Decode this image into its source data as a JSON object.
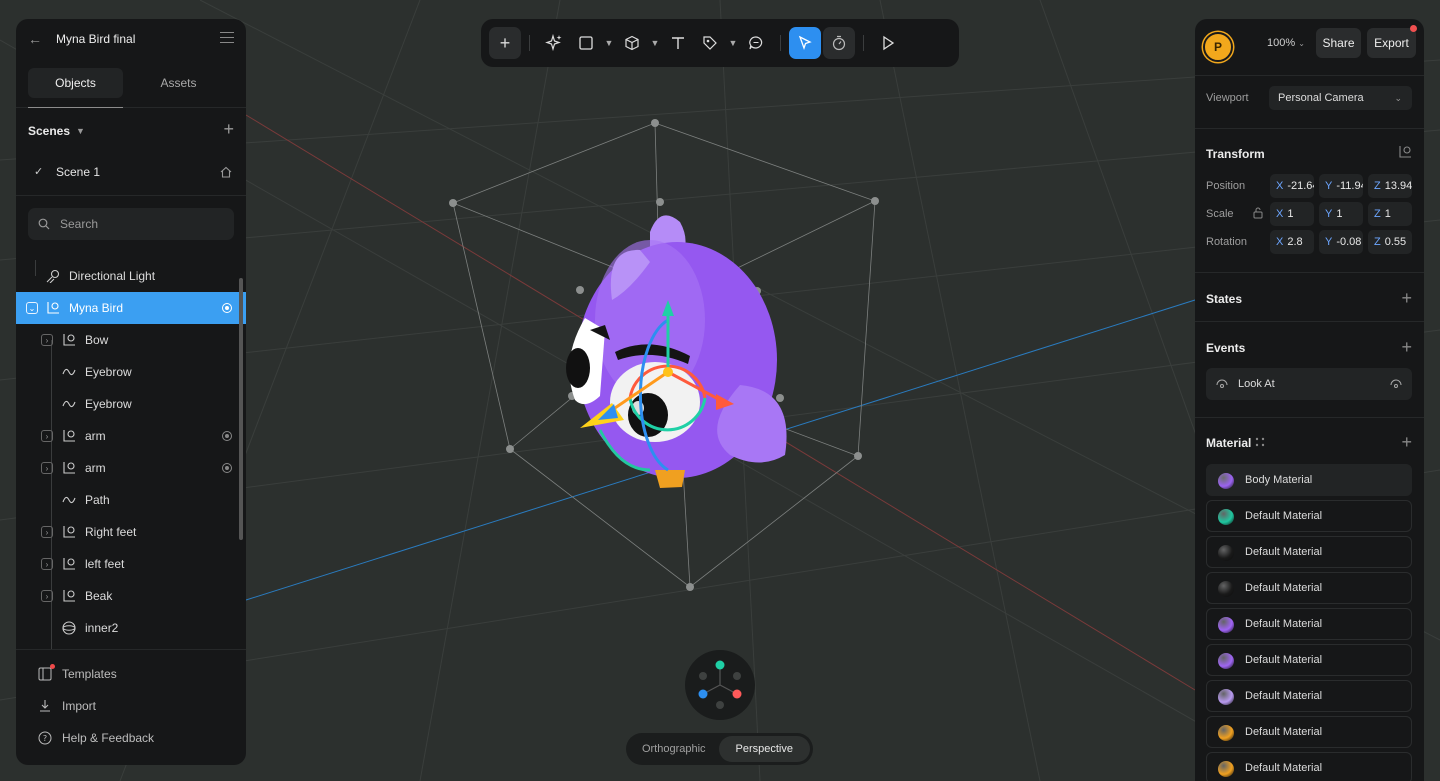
{
  "project": {
    "title": "Myna Bird final"
  },
  "tabs": {
    "objects": "Objects",
    "assets": "Assets"
  },
  "scenes": {
    "label": "Scenes",
    "items": [
      {
        "label": "Scene 1"
      }
    ]
  },
  "search": {
    "placeholder": "Search"
  },
  "layers": [
    {
      "label": "Directional Light",
      "icon": "light-icon",
      "depth": 0,
      "expandable": false,
      "visibility": false,
      "selected": false
    },
    {
      "label": "Myna Bird",
      "icon": "group-icon",
      "depth": 0,
      "expandable": true,
      "visibility": true,
      "selected": true
    },
    {
      "label": "Bow",
      "icon": "group-icon",
      "depth": 1,
      "expandable": true,
      "visibility": false,
      "selected": false
    },
    {
      "label": "Eyebrow",
      "icon": "path-icon",
      "depth": 1,
      "expandable": false,
      "visibility": false,
      "selected": false
    },
    {
      "label": "Eyebrow",
      "icon": "path-icon",
      "depth": 1,
      "expandable": false,
      "visibility": false,
      "selected": false
    },
    {
      "label": "arm",
      "icon": "group-icon",
      "depth": 1,
      "expandable": true,
      "visibility": true,
      "selected": false
    },
    {
      "label": "arm",
      "icon": "group-icon",
      "depth": 1,
      "expandable": true,
      "visibility": true,
      "selected": false
    },
    {
      "label": "Path",
      "icon": "path-icon",
      "depth": 1,
      "expandable": false,
      "visibility": false,
      "selected": false
    },
    {
      "label": "Right feet",
      "icon": "group-icon",
      "depth": 1,
      "expandable": true,
      "visibility": false,
      "selected": false
    },
    {
      "label": "left feet",
      "icon": "group-icon",
      "depth": 1,
      "expandable": true,
      "visibility": false,
      "selected": false
    },
    {
      "label": "Beak",
      "icon": "group-icon",
      "depth": 1,
      "expandable": true,
      "visibility": false,
      "selected": false
    },
    {
      "label": "inner2",
      "icon": "sphere-icon",
      "depth": 1,
      "expandable": false,
      "visibility": false,
      "selected": false
    }
  ],
  "footer": {
    "templates": "Templates",
    "import": "Import",
    "help": "Help & Feedback"
  },
  "toolbar": {
    "tools": [
      "plus",
      "ai-sparkle",
      "rectangle",
      "cube",
      "text",
      "pen",
      "comment",
      "select",
      "timer",
      "play"
    ]
  },
  "header": {
    "avatar_letter": "P",
    "zoom": "100%",
    "share": "Share",
    "export": "Export"
  },
  "viewport_setting": {
    "label": "Viewport",
    "value": "Personal Camera"
  },
  "transform": {
    "title": "Transform",
    "position_label": "Position",
    "scale_label": "Scale",
    "rotation_label": "Rotation",
    "position": {
      "x": "-21.64",
      "y": "-11.94",
      "z": "13.94"
    },
    "scale": {
      "x": "1",
      "y": "1",
      "z": "1"
    },
    "rotation": {
      "x": "2.8",
      "y": "-0.08",
      "z": "0.55"
    },
    "axis": {
      "x": "X",
      "y": "Y",
      "z": "Z"
    }
  },
  "states": {
    "title": "States"
  },
  "events": {
    "title": "Events",
    "items": [
      "Look At"
    ]
  },
  "material": {
    "title": "Material",
    "items": [
      {
        "label": "Body Material",
        "color": "#9b63f0"
      },
      {
        "label": "Default Material",
        "color": "#1fc7a0"
      },
      {
        "label": "Default Material",
        "color": "#1a1a1a"
      },
      {
        "label": "Default Material",
        "color": "#1a1a1a"
      },
      {
        "label": "Default Material",
        "color": "#a064f5"
      },
      {
        "label": "Default Material",
        "color": "#9f66f2"
      },
      {
        "label": "Default Material",
        "color": "#b89af0"
      },
      {
        "label": "Default Material",
        "color": "#f0a020"
      },
      {
        "label": "Default Material",
        "color": "#f0a020"
      }
    ]
  },
  "projection": {
    "orthographic": "Orthographic",
    "perspective": "Perspective"
  }
}
